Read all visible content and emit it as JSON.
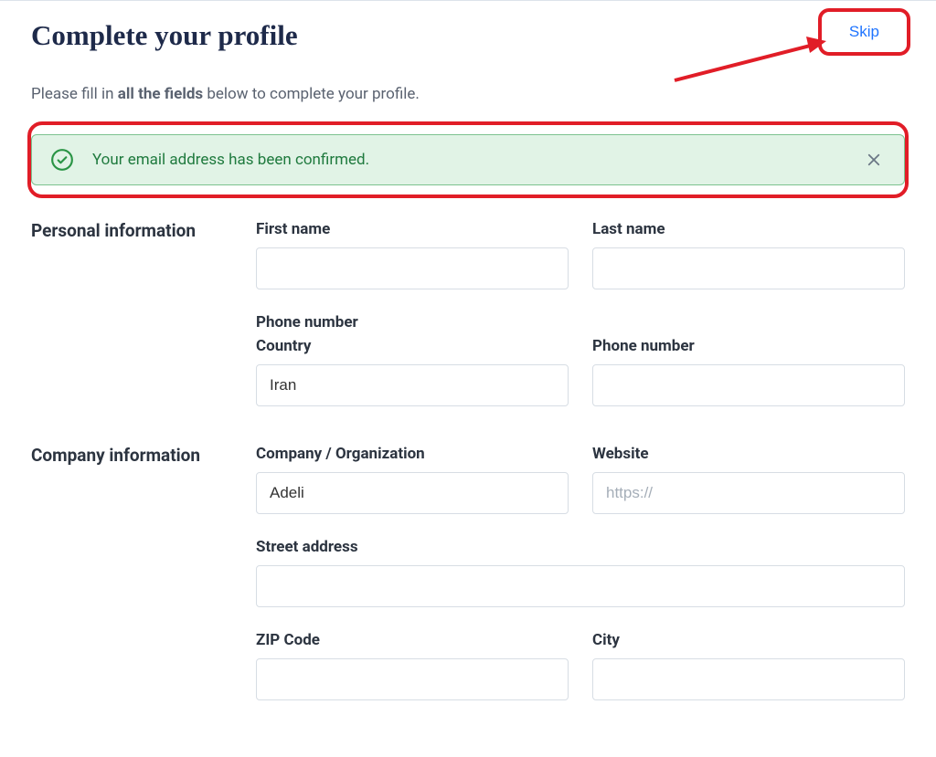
{
  "header": {
    "title": "Complete your profile",
    "skip_label": "Skip"
  },
  "subheading": {
    "prefix": "Please fill in ",
    "bold": "all the fields",
    "suffix": " below to complete your profile."
  },
  "alert": {
    "message": "Your email address has been confirmed."
  },
  "personal": {
    "section_title": "Personal information",
    "first_name_label": "First name",
    "first_name_value": "",
    "last_name_label": "Last name",
    "last_name_value": "",
    "phone_group_label": "Phone number",
    "country_label": "Country",
    "country_value": "Iran",
    "phone_label": "Phone number",
    "phone_value": ""
  },
  "company": {
    "section_title": "Company information",
    "company_label": "Company / Organization",
    "company_value": "Adeli",
    "website_label": "Website",
    "website_placeholder": "https://",
    "website_value": "",
    "street_label": "Street address",
    "street_value": "",
    "zip_label": "ZIP Code",
    "zip_value": "",
    "city_label": "City",
    "city_value": ""
  },
  "annotations": {
    "arrow_color": "#e11d27",
    "highlight_color": "#e11d27"
  }
}
